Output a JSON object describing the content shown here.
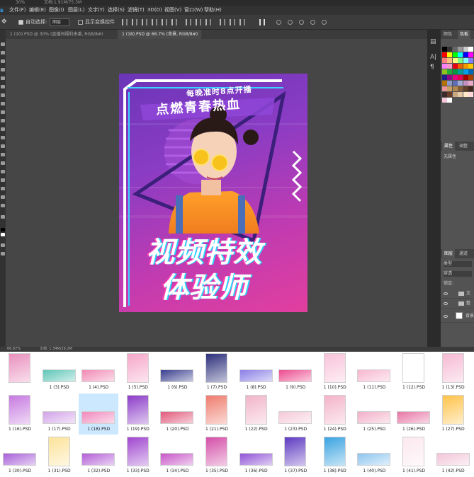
{
  "topstrip": {
    "zoom": "30%",
    "doc": "文档:1.91M/75.3M"
  },
  "menu": {
    "logo": "s",
    "items": [
      "文件(F)",
      "编辑(E)",
      "图像(I)",
      "图层(L)",
      "文字(Y)",
      "选择(S)",
      "滤镜(T)",
      "3D(D)",
      "视图(V)",
      "窗口(W)",
      "帮助(H)"
    ]
  },
  "options": {
    "auto_select": "自动选择:",
    "auto_select_value": "图层",
    "show_transform": "显示变换控件"
  },
  "tabs": [
    {
      "label": "1 (10).PSD @ 30% (直播间福利来袭, RGB/8#)",
      "active": false
    },
    {
      "label": "1 (18).PSD @ 66.7% (背景, RGB/8#)",
      "active": true
    }
  ],
  "dock": {
    "icons": [
      "layers-dock-icon",
      "text-dock-icon",
      "paragraph-dock-icon"
    ],
    "labels": [
      "A|",
      "¶"
    ]
  },
  "panels": {
    "swatch_tabs": [
      "颜色",
      "色板"
    ],
    "swatch_colors": [
      "#000000",
      "#333333",
      "#666666",
      "#999999",
      "#cccccc",
      "#ffffff",
      "#ff0000",
      "#ffff00",
      "#00ff00",
      "#00ffff",
      "#0000ff",
      "#ff00ff",
      "#ff7f7f",
      "#ffbf7f",
      "#ffff7f",
      "#7fff7f",
      "#7fffff",
      "#7f7fff",
      "#ff7fff",
      "#ff99cc",
      "#e60012",
      "#eb6100",
      "#f39800",
      "#fcc800",
      "#8fc31f",
      "#22ac38",
      "#009944",
      "#009e96",
      "#00a0e9",
      "#0068b7",
      "#1d2088",
      "#920783",
      "#e4007f",
      "#e5004f",
      "#a40000",
      "#a84200",
      "#b67200",
      "#8c97cb",
      "#5f6ebb",
      "#a3abd5",
      "#c490bf",
      "#e9aac8",
      "#ea9399",
      "#c9a063",
      "#b28850",
      "#845e38",
      "#60402a",
      "#402a1e",
      "#3a2a28",
      "#6a3d2b",
      "#c8a782",
      "#e4c9a6",
      "#ffe7c8",
      "#ffd9d9",
      "#f7c6d8",
      "#ffffff"
    ],
    "props_tabs": [
      "属性",
      "调整"
    ],
    "props_text": "无属性",
    "layers_tabs": [
      "图层",
      "通道"
    ],
    "layers_kind": "类型",
    "layers_mode": "穿透",
    "layers_lock": "锁定:",
    "layers": [
      {
        "name": "文",
        "type": "folder"
      },
      {
        "name": "整",
        "type": "folder"
      },
      {
        "name": "背景",
        "type": "image"
      }
    ]
  },
  "status": {
    "zoom": "66.67%",
    "doc": "文档: 1.34M/29.2M"
  },
  "poster": {
    "tagline": "每晚准时8点开播",
    "subtitle": "点燃青春热血",
    "title_line1": "视频特效",
    "title_line2": "体验师"
  },
  "files": [
    {
      "label": "",
      "kind": "portrait",
      "color": "#e98fbd"
    },
    {
      "label": "1 (3).PSD",
      "kind": "banner",
      "color": "#5fc6b7"
    },
    {
      "label": "1 (4).PSD",
      "kind": "banner",
      "color": "#f18bb5"
    },
    {
      "label": "1 (5).PSD",
      "kind": "portrait",
      "color": "#f5a6c8"
    },
    {
      "label": "1 (6).PSD",
      "kind": "banner",
      "color": "#3a3f8f"
    },
    {
      "label": "1 (7).PSD",
      "kind": "portrait",
      "color": "#2b2f7a"
    },
    {
      "label": "1 (8).PSD",
      "kind": "banner",
      "color": "#8a7fe6"
    },
    {
      "label": "1 (9).PSD",
      "kind": "banner",
      "color": "#ec4c8f"
    },
    {
      "label": "1 (10).PSD",
      "kind": "portrait",
      "color": "#f8c2d9"
    },
    {
      "label": "1 (11).PSD",
      "kind": "banner",
      "color": "#f7b7cf"
    },
    {
      "label": "1 (12).PSD",
      "kind": "portrait",
      "color": "#ffffff"
    },
    {
      "label": "1 (13).PSD",
      "kind": "portrait",
      "color": "#f6b9d3"
    },
    {
      "label": "1 (16).PSD",
      "kind": "portrait",
      "color": "#c67ae0"
    },
    {
      "label": "1 (17).PSD",
      "kind": "banner",
      "color": "#d2a4e8"
    },
    {
      "label": "1 (18).PSD",
      "kind": "banner",
      "color": "#f089bd"
    },
    {
      "label": "1 (19).PSD",
      "kind": "portrait",
      "color": "#8c3cc8"
    },
    {
      "label": "1 (20).PSD",
      "kind": "banner",
      "color": "#e15a7b"
    },
    {
      "label": "1 (21).PSD",
      "kind": "portrait",
      "color": "#ef7c6d"
    },
    {
      "label": "1 (22).PSD",
      "kind": "portrait",
      "color": "#f1b4c9"
    },
    {
      "label": "1 (23).PSD",
      "kind": "banner",
      "color": "#f5c9d9"
    },
    {
      "label": "1 (24).PSD",
      "kind": "portrait",
      "color": "#f3b3c9"
    },
    {
      "label": "1 (25).PSD",
      "kind": "banner",
      "color": "#f2b0c8"
    },
    {
      "label": "1 (26).PSD",
      "kind": "banner",
      "color": "#e876a5"
    },
    {
      "label": "1 (27).PSD",
      "kind": "portrait",
      "color": "#ffc34a"
    },
    {
      "label": "1 (30).PSD",
      "kind": "banner",
      "color": "#a85fd9"
    },
    {
      "label": "1 (31).PSD",
      "kind": "portrait",
      "color": "#fce39a"
    },
    {
      "label": "1 (32).PSD",
      "kind": "banner",
      "color": "#b35fd6"
    },
    {
      "label": "1 (33).PSD",
      "kind": "portrait",
      "color": "#9f47cf"
    },
    {
      "label": "1 (34).PSD",
      "kind": "banner",
      "color": "#c855c7"
    },
    {
      "label": "1 (35).PSD",
      "kind": "portrait",
      "color": "#d44fa8"
    },
    {
      "label": "1 (36).PSD",
      "kind": "banner",
      "color": "#8f53d6"
    },
    {
      "label": "1 (37).PSD",
      "kind": "portrait",
      "color": "#5e3ac1"
    },
    {
      "label": "1 (38).PSD",
      "kind": "portrait",
      "color": "#3aa3e0"
    },
    {
      "label": "1 (40).PSD",
      "kind": "banner",
      "color": "#8ec6ef"
    },
    {
      "label": "1 (41).PSD",
      "kind": "portrait",
      "color": "#fbe8ef"
    },
    {
      "label": "1 (42).PSD",
      "kind": "banner",
      "color": "#f2c5d8"
    }
  ],
  "selected_file": "1 (18).PSD"
}
